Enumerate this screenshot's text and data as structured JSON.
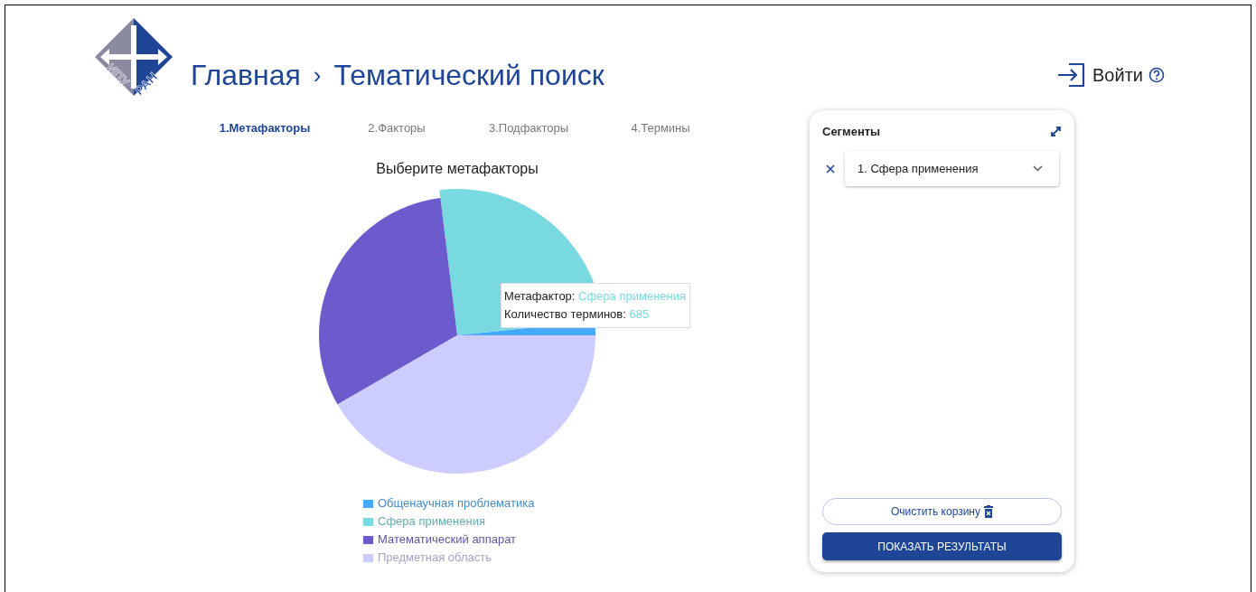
{
  "header": {
    "logo": {
      "left_text": "ИПУ",
      "right_text": "РАН"
    },
    "breadcrumbs": [
      {
        "label": "Главная"
      },
      {
        "label": "Тематический поиск"
      }
    ],
    "separator": "›",
    "login": {
      "label": "Войти"
    }
  },
  "steps": [
    {
      "label": "1.Метафакторы",
      "selected": true
    },
    {
      "label": "2.Факторы",
      "selected": false
    },
    {
      "label": "3.Подфакторы",
      "selected": false
    },
    {
      "label": "4.Термины",
      "selected": false
    }
  ],
  "chart": {
    "title": "Выберите метафакторы",
    "legend": [
      {
        "label": "Общенаучная проблематика",
        "color": "#45aaff",
        "highlighted": false
      },
      {
        "label": "Сфера применения",
        "color": "#78d9e0",
        "highlighted": true
      },
      {
        "label": "Математический аппарат",
        "color": "#6b5bcc",
        "highlighted": false
      },
      {
        "label": "Предметная область",
        "color": "#ccccff",
        "highlighted": false
      }
    ],
    "tooltip": [
      {
        "label": "Метафактор:",
        "value": "Сфера применения"
      },
      {
        "label": "Количество терминов:",
        "value": "685"
      }
    ]
  },
  "segments": {
    "title": "Сегменты",
    "items": [
      {
        "label": "1. Сфера применения"
      }
    ],
    "clear_button": "Очистить корзину",
    "show_button": "ПОКАЗАТЬ РЕЗУЛЬТАТЫ"
  }
}
